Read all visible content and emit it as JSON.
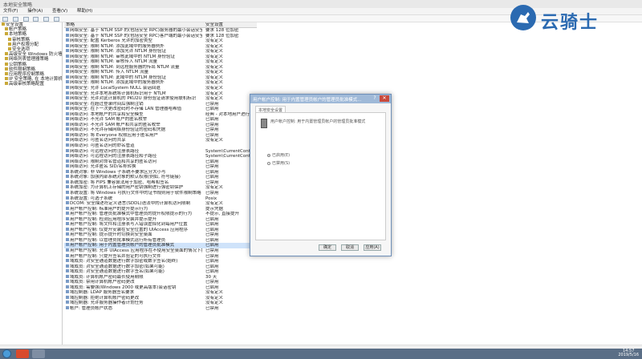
{
  "window": {
    "title": "本地安全策略"
  },
  "menu": [
    "文件(F)",
    "操作(A)",
    "查看(V)",
    "帮助(H)"
  ],
  "tree": [
    {
      "label": "安全设置",
      "indent": 0
    },
    {
      "label": "帐户策略",
      "indent": 1
    },
    {
      "label": "本地策略",
      "indent": 1
    },
    {
      "label": "审核策略",
      "indent": 2
    },
    {
      "label": "用户权限分配",
      "indent": 2
    },
    {
      "label": "安全选项",
      "indent": 2
    },
    {
      "label": "高级安全 Windows 防火墙",
      "indent": 1
    },
    {
      "label": "网络列表管理器策略",
      "indent": 1
    },
    {
      "label": "公钥策略",
      "indent": 1
    },
    {
      "label": "软件限制策略",
      "indent": 1
    },
    {
      "label": "应用程序控制策略",
      "indent": 1
    },
    {
      "label": "IP 安全策略, 在 本地计算机",
      "indent": 1
    },
    {
      "label": "高级审核策略配置",
      "indent": 1
    }
  ],
  "list": {
    "col_policy": "策略",
    "col_setting": "安全设置",
    "rows": [
      {
        "name": "网络安全: 基于 NTLM SSP 的(包括安全 RPC)服务器的最小会话安全",
        "val": "要求 128 位加密"
      },
      {
        "name": "网络安全: 基于 NTLM SSP 的(包括安全 RPC)客户端的最小会话安全",
        "val": "要求 128 位加密"
      },
      {
        "name": "网络安全: 配置 Kerberos 允许的加密类型",
        "val": "没有定义"
      },
      {
        "name": "网络安全: 限制 NTLM: 添加此域中的服务器例外",
        "val": "没有定义"
      },
      {
        "name": "网络安全: 限制 NTLM: 添加允许 NTLM 身份验证",
        "val": "没有定义"
      },
      {
        "name": "网络安全: 限制 NTLM: 审核此域中的 NTLM 身份验证",
        "val": "没有定义"
      },
      {
        "name": "网络安全: 限制 NTLM: 审核传入 NTLM 流量",
        "val": "没有定义"
      },
      {
        "name": "网络安全: 限制 NTLM: 到远程服务器的传出 NTLM 流量",
        "val": "没有定义"
      },
      {
        "name": "网络安全: 限制 NTLM: 传入 NTLM 流量",
        "val": "没有定义"
      },
      {
        "name": "网络安全: 限制 NTLM: 此域中的 NTLM 身份验证",
        "val": "没有定义"
      },
      {
        "name": "网络安全: 限制 NTLM: 添加此域中的服务器例外",
        "val": "没有定义"
      },
      {
        "name": "网络安全: 允许 LocalSystem NULL 会话回退",
        "val": "没有定义"
      },
      {
        "name": "网络安全: 允许本地系统将计算机标识用于 NTLM",
        "val": "没有定义"
      },
      {
        "name": "网络安全: 允许对此计算机的 PKU2U 身份验证请求使用联机标识",
        "val": "没有定义"
      },
      {
        "name": "网络安全: 在超过登录时间后强制注销",
        "val": "已禁用"
      },
      {
        "name": "网络安全: 在下一次更改密码时不存储 LAN 管理器哈希值",
        "val": "已启用"
      },
      {
        "name": "网络访问: 本地帐户的共享和安全模型",
        "val": "经典 - 对本地用户进行..."
      },
      {
        "name": "网络访问: 不允许 SAM 帐户的匿名枚举",
        "val": "已启用"
      },
      {
        "name": "网络访问: 不允许 SAM 帐户和共享的匿名枚举",
        "val": "已禁用"
      },
      {
        "name": "网络访问: 不允许存储网络身份验证的密码和凭据",
        "val": "已禁用"
      },
      {
        "name": "网络访问: 将 Everyone 权限应用于匿名用户",
        "val": "已禁用"
      },
      {
        "name": "网络访问: 可匿名访问的共享",
        "val": "没有定义"
      },
      {
        "name": "网络访问: 可匿名访问的命名管道",
        "val": ""
      },
      {
        "name": "网络访问: 可远程访问的注册表路径",
        "val": "System\\CurrentContr..."
      },
      {
        "name": "网络访问: 可远程访问的注册表路径和子路径",
        "val": "System\\CurrentContr..."
      },
      {
        "name": "网络访问: 限制对命名管道和共享的匿名访问",
        "val": "已启用"
      },
      {
        "name": "网络访问: 允许匿名 SID/名称转换",
        "val": "已禁用"
      },
      {
        "name": "系统对象: 非 Windows 子系统不要求区分大小写",
        "val": "已启用"
      },
      {
        "name": "系统对象: 加强内部系统对象的默认权限(例如, 符号链接)",
        "val": "已启用"
      },
      {
        "name": "系统加密: 将 FIPS 兼容算法用于加密、哈希和签名",
        "val": "已禁用"
      },
      {
        "name": "系统加密: 为计算机上存储的用户密钥强制进行强密钥保护",
        "val": "没有定义"
      },
      {
        "name": "系统设置: 将 Windows 可执行文件中的证书规则用于软件限制策略",
        "val": "已禁用"
      },
      {
        "name": "系统设置: 可选子系统",
        "val": "Posix"
      },
      {
        "name": "DCOM: 安全描述符定义语言(SDDL)语法中的计算机访问限制",
        "val": "没有定义"
      },
      {
        "name": "用户帐户控制: 标准用户的提升提示行为",
        "val": "提示凭据"
      },
      {
        "name": "用户帐户控制: 管理员批准模式中管理员的提升权限提示的行为",
        "val": "不提示, 直接提升"
      },
      {
        "name": "用户帐户控制: 检测应用程序安装并提示提升",
        "val": "已启用"
      },
      {
        "name": "用户帐户控制: 将文件和注册表写入错误虚拟化到每用户位置",
        "val": "已启用"
      },
      {
        "name": "用户帐户控制: 仅提升安装在安全位置的 UIAccess 应用程序",
        "val": "已启用"
      },
      {
        "name": "用户帐户控制: 提示提升时切换到安全桌面",
        "val": "已禁用"
      },
      {
        "name": "用户帐户控制: 以管理员批准模式运行所有管理员",
        "val": "已启用"
      },
      {
        "name": "用户帐户控制: 用于内置管理员帐户的管理员批准模式",
        "val": "已启用"
      },
      {
        "name": "用户帐户控制: 允许 UIAccess 应用程序在不使用安全桌面的情况下提升权限",
        "val": "已禁用"
      },
      {
        "name": "用户帐户控制: 只提升签名并验证的可执行文件",
        "val": "已禁用"
      },
      {
        "name": "域成员: 对安全通道数据进行数字加密或数字签名(始终)",
        "val": "已启用"
      },
      {
        "name": "域成员: 对安全通道数据进行数字加密(如果可能)",
        "val": "已启用"
      },
      {
        "name": "域成员: 对安全通道数据进行数字签名(如果可能)",
        "val": "已启用"
      },
      {
        "name": "域成员: 计算机帐户密码最长使用期限",
        "val": "30 天"
      },
      {
        "name": "域成员: 禁用计算机帐户密码更改",
        "val": "已禁用"
      },
      {
        "name": "域成员: 需要强(Windows 2000 或更高版本)会话密钥",
        "val": "已启用"
      },
      {
        "name": "域控制器: LDAP 服务器签名要求",
        "val": "没有定义"
      },
      {
        "name": "域控制器: 拒绝计算机帐户密码更改",
        "val": "没有定义"
      },
      {
        "name": "域控制器: 允许服务器操作者计划任务",
        "val": "没有定义"
      },
      {
        "name": "帐户: 管理员帐户状态",
        "val": "已禁用"
      }
    ],
    "selected_index": 41
  },
  "dialog": {
    "title": "用户帐户控制: 用于内置管理员帐户的管理员批准模式...",
    "help": "?",
    "tab": "本地安全设置",
    "description": "用户帐户控制: 用于内置管理员帐户的管理员批准模式",
    "option_enabled": "已启用(E)",
    "option_disabled": "已禁用(S)",
    "selected": "enabled",
    "btn_ok": "确定",
    "btn_cancel": "取消",
    "btn_apply": "应用(A)"
  },
  "watermark": {
    "text": "云骑士"
  },
  "taskbar": {
    "time": "14:57",
    "date": "2019/5/16"
  },
  "colors": {
    "selection": "#cfe3fa",
    "taskbar": "#5a6e86",
    "brand": "#2b6ab1"
  }
}
